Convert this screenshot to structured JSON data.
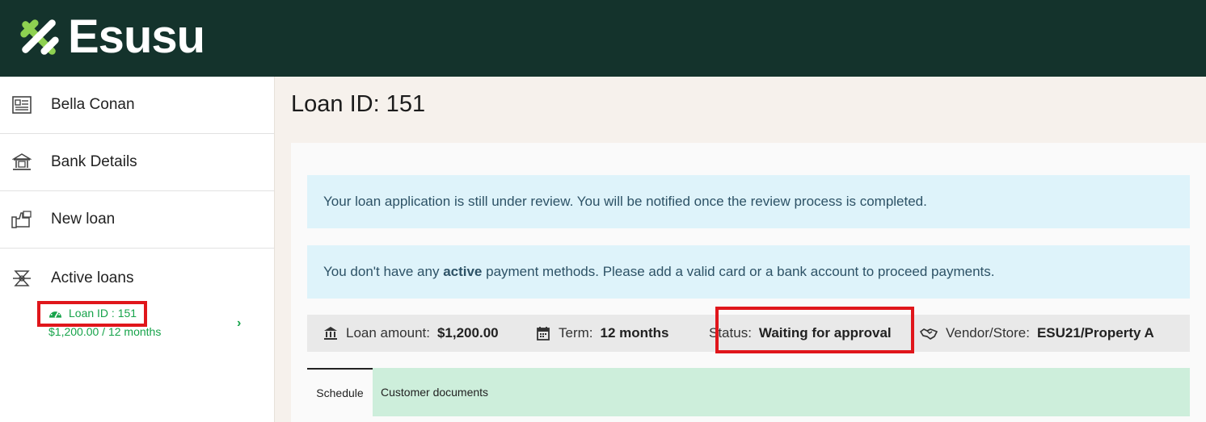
{
  "header": {
    "brand": "Esusu"
  },
  "sidebar": {
    "items": [
      {
        "label": "Bella Conan",
        "icon": "profile-card-icon"
      },
      {
        "label": "Bank Details",
        "icon": "bank-icon"
      },
      {
        "label": "New loan",
        "icon": "new-loan-icon"
      },
      {
        "label": "Active loans",
        "icon": "active-loans-icon"
      }
    ],
    "active_loan": {
      "id_label": "Loan ID : 151",
      "summary": "$1,200.00 / 12 months",
      "icon": "speedometer-icon"
    }
  },
  "main": {
    "title": "Loan ID: 151",
    "alerts": {
      "review": "Your loan application is still under review. You will be notified once the review process is completed.",
      "payment_prefix": "You don't have any ",
      "payment_bold": "active",
      "payment_suffix": " payment methods. Please add a valid card or a bank account to proceed payments."
    },
    "info": {
      "amount_label": "Loan amount:",
      "amount_value": "$1,200.00",
      "term_label": "Term:",
      "term_value": "12 months",
      "status_label": "Status:",
      "status_value": "Waiting for approval",
      "vendor_label": "Vendor/Store:",
      "vendor_value": "ESU21/Property A"
    },
    "tabs": [
      {
        "label": "Schedule"
      },
      {
        "label": "Customer documents"
      }
    ]
  },
  "colors": {
    "header_bg": "#14332c",
    "accent_green": "#16a34a",
    "highlight_red": "#e0161b",
    "alert_bg": "#def3fa",
    "tab_bar_bg": "#cdeedb"
  }
}
